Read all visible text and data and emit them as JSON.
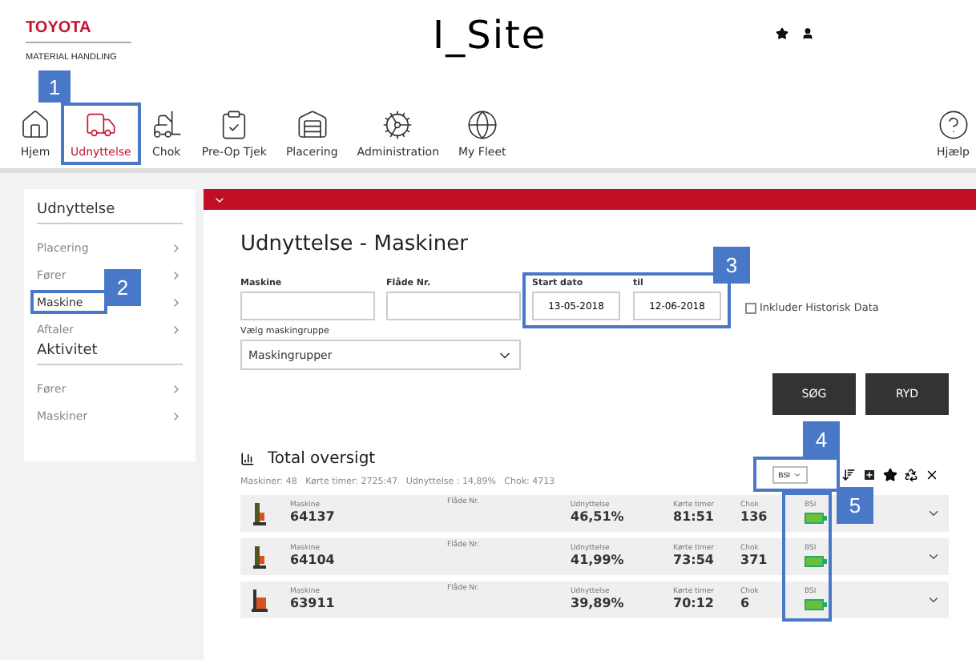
{
  "header": {
    "brand": "TOYOTA",
    "subbrand": "MATERIAL HANDLING",
    "app_title": "I_Site"
  },
  "nav": [
    {
      "label": "Hjem",
      "selected": false
    },
    {
      "label": "Udnyttelse",
      "selected": true,
      "callout": "1"
    },
    {
      "label": "Chok",
      "selected": false
    },
    {
      "label": "Pre-Op Tjek",
      "selected": false
    },
    {
      "label": "Placering",
      "selected": false
    },
    {
      "label": "Administration",
      "selected": false
    },
    {
      "label": "My Fleet",
      "selected": false
    },
    {
      "label": "Hjælp",
      "selected": false
    }
  ],
  "sidebar": {
    "sections": [
      {
        "title": "Udnyttelse",
        "items": [
          {
            "label": "Placering",
            "selected": false
          },
          {
            "label": "Fører",
            "selected": false
          },
          {
            "label": "Maskine",
            "selected": true,
            "callout": "2"
          },
          {
            "label": "Aftaler",
            "selected": false
          }
        ]
      },
      {
        "title": "Aktivitet",
        "items": [
          {
            "label": "Fører",
            "selected": false
          },
          {
            "label": "Maskiner",
            "selected": false
          }
        ]
      }
    ]
  },
  "page_title": "Udnyttelse - Maskiner",
  "form": {
    "machine_label": "Maskine",
    "fleet_label": "Flåde Nr.",
    "start_label": "Start dato",
    "start_value": "13-05-2018",
    "end_label": "til",
    "end_value": "12-06-2018",
    "date_callout": "3",
    "history_label": "Inkluder Historisk Data",
    "history_checked": false,
    "group_label": "Vælg maskingruppe",
    "group_value": "Maskingrupper",
    "buttons": [
      "SØG",
      "RYD"
    ]
  },
  "overview": {
    "title": "Total oversigt",
    "summary": "Maskiner: 48   Kørte timer: 2725:47   Udnyttelse : 14,89%   Chok: 4713",
    "selector": "BSI",
    "selector_callout": "4",
    "bsi_callout": "5"
  },
  "rows": [
    {
      "machine_label": "Maskine",
      "machine": "64137",
      "fleet_label": "Flåde Nr.",
      "util_label": "Udnyttelse",
      "util": "46,51%",
      "hours_label": "Kørte timer",
      "hours": "81:51",
      "shock_label": "Chok",
      "shock": "136",
      "bsi_label": "BSI",
      "kind": "reach"
    },
    {
      "machine_label": "Maskine",
      "machine": "64104",
      "fleet_label": "Flåde Nr.",
      "util_label": "Udnyttelse",
      "util": "41,99%",
      "hours_label": "Kørte timer",
      "hours": "73:54",
      "shock_label": "Chok",
      "shock": "371",
      "bsi_label": "BSI",
      "kind": "reach"
    },
    {
      "machine_label": "Maskine",
      "machine": "63911",
      "fleet_label": "Flåde Nr.",
      "util_label": "Udnyttelse",
      "util": "39,89%",
      "hours_label": "Kørte timer",
      "hours": "70:12",
      "shock_label": "Chok",
      "shock": "6",
      "bsi_label": "BSI",
      "kind": "stacker"
    }
  ]
}
